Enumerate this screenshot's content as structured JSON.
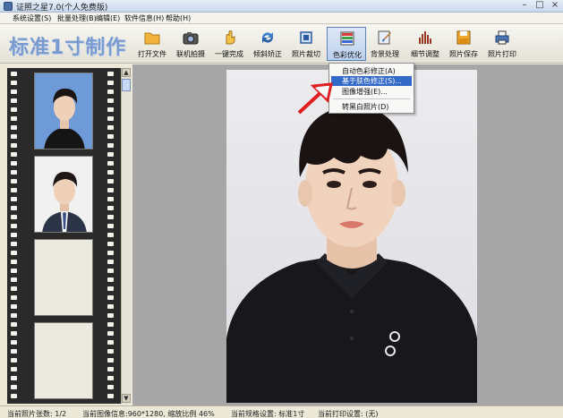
{
  "window": {
    "title": "证照之星7.0(个人免费版)"
  },
  "menubar": {
    "items": [
      "系统设置(S)",
      "批量处理(B)",
      "编辑(E)",
      "软件信息(H)",
      "帮助(H)"
    ]
  },
  "toolbar": {
    "brand": "标准1寸制作",
    "tools": [
      {
        "label": "打开文件",
        "icon": "folder-icon"
      },
      {
        "label": "联机拍摄",
        "icon": "camera-icon"
      },
      {
        "label": "一键完成",
        "icon": "hand-icon"
      },
      {
        "label": "倾斜矫正",
        "icon": "rotate-arrows-icon"
      },
      {
        "label": "照片裁切",
        "icon": "crop-icon"
      },
      {
        "label": "色彩优化",
        "icon": "color-palette-icon"
      },
      {
        "label": "背景处理",
        "icon": "paint-brush-icon"
      },
      {
        "label": "细节调整",
        "icon": "levels-icon"
      },
      {
        "label": "照片保存",
        "icon": "floppy-disk-icon"
      },
      {
        "label": "照片打印",
        "icon": "printer-icon"
      }
    ]
  },
  "color_menu": {
    "items": [
      "自动色彩修正(A)",
      "基于肤色修正(S)...",
      "图像增强(E)...",
      "转黑白照片(D)"
    ],
    "highlighted_index": 1
  },
  "statusbar": {
    "photo_count": "当前照片张数: 1/2",
    "image_info": "当前图像信息:960*1280, 缩放比例 46%",
    "spec": "当前规格设置: 标准1寸",
    "print": "当前打印设置: (无)"
  },
  "colors": {
    "brand": "#7a9bcf",
    "menu_highlight": "#3369c8",
    "arrow": "#e02020",
    "film": "#2a2a2a",
    "canvas": "#a6a6a6"
  }
}
